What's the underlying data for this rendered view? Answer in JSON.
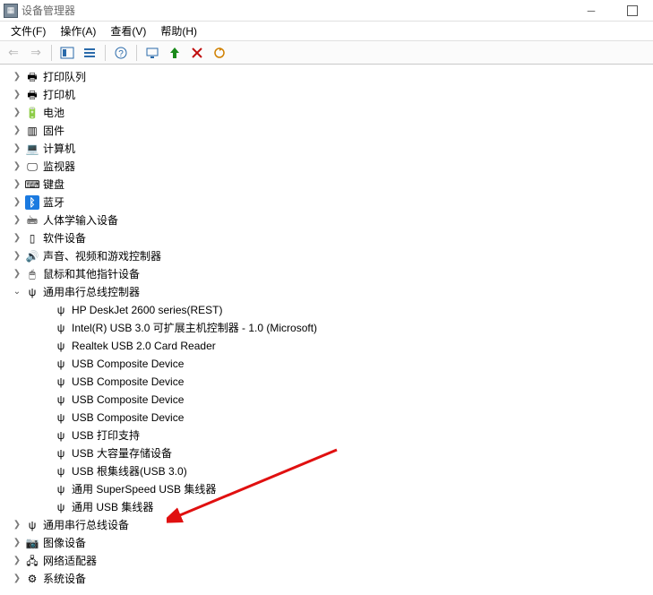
{
  "window": {
    "title": "设备管理器"
  },
  "menu": {
    "file": "文件(F)",
    "action": "操作(A)",
    "view": "查看(V)",
    "help": "帮助(H)"
  },
  "tree": {
    "cats": [
      {
        "icon": "🖶",
        "label": "打印队列"
      },
      {
        "icon": "🖶",
        "label": "打印机"
      },
      {
        "icon": "🔋",
        "label": "电池"
      },
      {
        "icon": "▥",
        "label": "固件"
      },
      {
        "icon": "💻",
        "label": "计算机"
      },
      {
        "icon": "🖵",
        "label": "监视器"
      },
      {
        "icon": "⌨",
        "label": "键盘"
      },
      {
        "icon": "ᛒ",
        "label": "蓝牙"
      },
      {
        "icon": "🖮",
        "label": "人体学输入设备"
      },
      {
        "icon": "▯",
        "label": "软件设备"
      },
      {
        "icon": "🔊",
        "label": "声音、视频和游戏控制器"
      },
      {
        "icon": "🖱",
        "label": "鼠标和其他指针设备"
      }
    ],
    "usb_cat_label": "通用串行总线控制器",
    "usb_children": [
      {
        "label": "HP DeskJet 2600 series(REST)"
      },
      {
        "label": "Intel(R) USB 3.0 可扩展主机控制器 - 1.0 (Microsoft)"
      },
      {
        "label": "Realtek USB 2.0 Card Reader"
      },
      {
        "label": "USB Composite Device"
      },
      {
        "label": "USB Composite Device"
      },
      {
        "label": "USB Composite Device"
      },
      {
        "label": "USB Composite Device"
      },
      {
        "label": "USB 打印支持"
      },
      {
        "label": "USB 大容量存储设备"
      },
      {
        "label": "USB 根集线器(USB 3.0)"
      },
      {
        "label": "通用 SuperSpeed USB 集线器"
      },
      {
        "label": "通用 USB 集线器"
      }
    ],
    "cats_after": [
      {
        "icon": "ψ",
        "label": "通用串行总线设备"
      },
      {
        "icon": "📷",
        "label": "图像设备"
      },
      {
        "icon": "🖧",
        "label": "网络适配器"
      },
      {
        "icon": "⚙",
        "label": "系统设备"
      }
    ]
  },
  "annotation": {
    "target": "tree.usb_children.8.label"
  }
}
